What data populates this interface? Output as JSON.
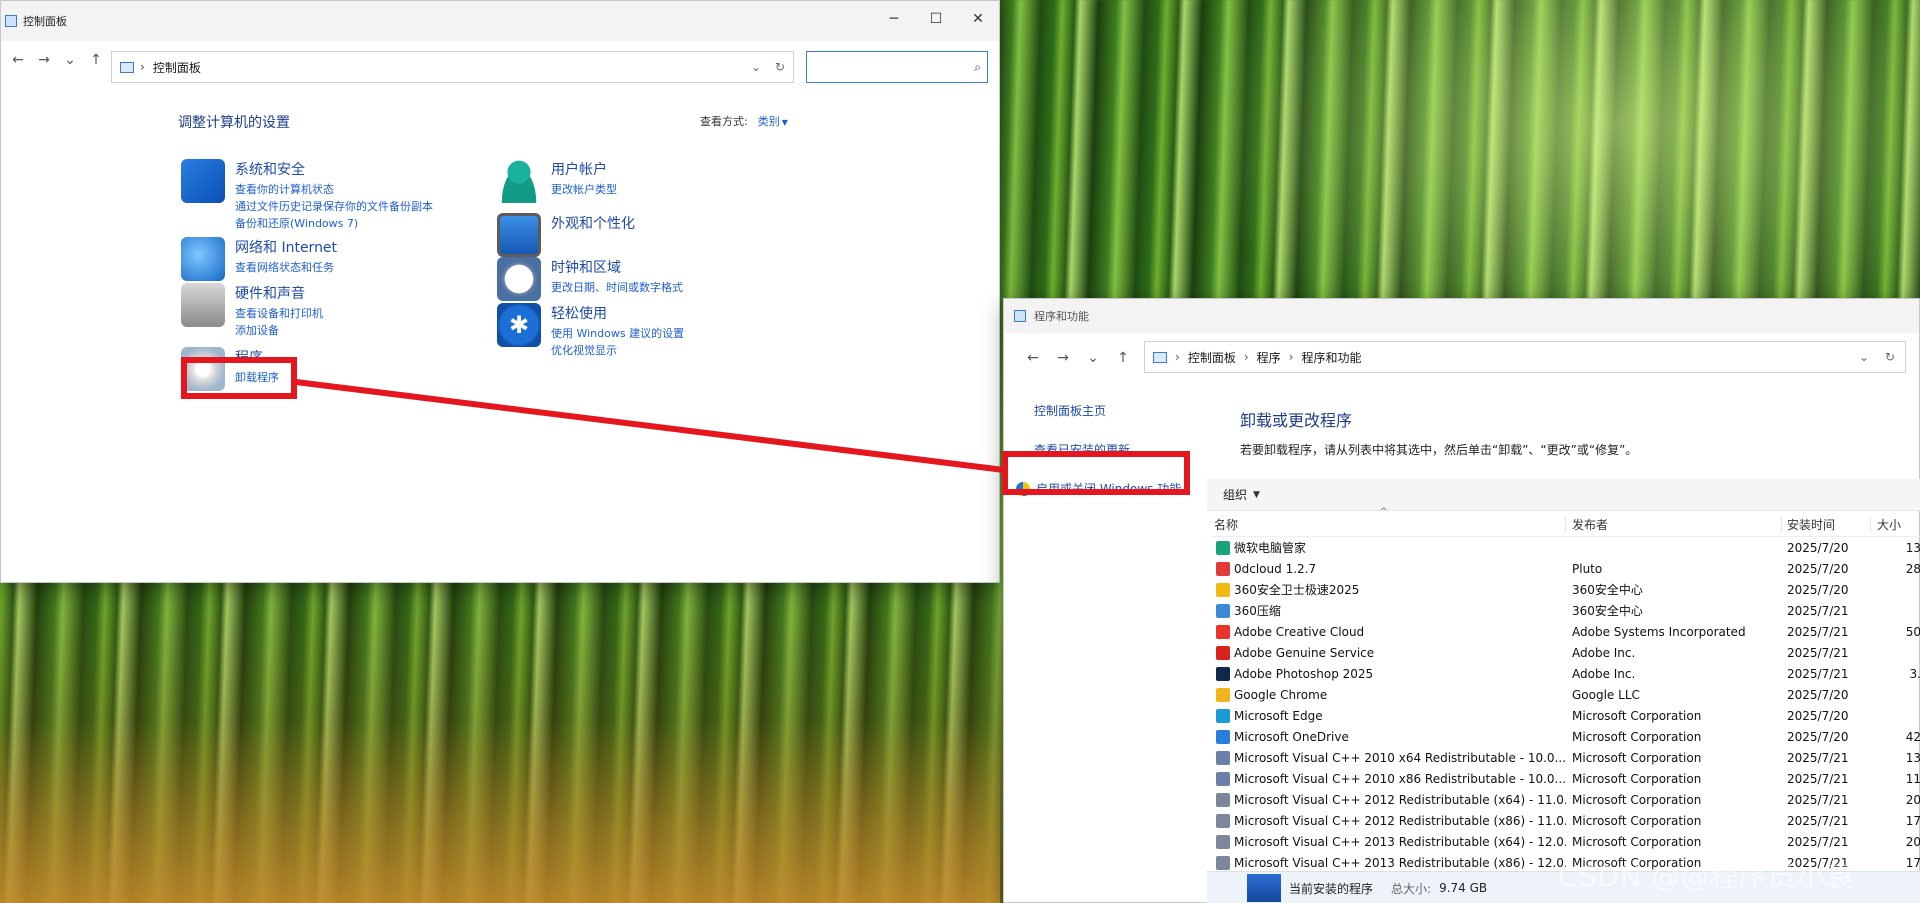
{
  "control_panel": {
    "title": "控制面板",
    "address": "控制面板",
    "heading": "调整计算机的设置",
    "view_label": "查看方式:",
    "view_value": "类别",
    "categories": [
      {
        "head": "系统和安全",
        "subs": [
          "查看你的计算机状态",
          "通过文件历史记录保存你的文件备份副本",
          "备份和还原(Windows 7)"
        ],
        "icon": "shield-icon"
      },
      {
        "head": "网络和 Internet",
        "subs": [
          "查看网络状态和任务"
        ],
        "icon": "globe-icon"
      },
      {
        "head": "硬件和声音",
        "subs": [
          "查看设备和打印机",
          "添加设备"
        ],
        "icon": "printer-icon"
      },
      {
        "head": "程序",
        "subs": [
          "卸载程序"
        ],
        "icon": "disc-icon"
      },
      {
        "head": "用户帐户",
        "subs": [
          "更改帐户类型"
        ],
        "icon": "user-icon"
      },
      {
        "head": "外观和个性化",
        "subs": [],
        "icon": "monitor-icon"
      },
      {
        "head": "时钟和区域",
        "subs": [
          "更改日期、时间或数字格式"
        ],
        "icon": "clock-icon"
      },
      {
        "head": "轻松使用",
        "subs": [
          "使用 Windows 建议的设置",
          "优化视觉显示"
        ],
        "icon": "accessibility-icon"
      }
    ]
  },
  "programs": {
    "title": "程序和功能",
    "breadcrumb": [
      "控制面板",
      "程序",
      "程序和功能"
    ],
    "sidebar": [
      "控制面板主页",
      "查看已安装的更新",
      "启用或关闭 Windows 功能"
    ],
    "heading": "卸载或更改程序",
    "description": "若要卸载程序，请从列表中将其选中，然后单击“卸载”、“更改”或“修复”。",
    "organize": "组织",
    "columns": [
      "名称",
      "发布者",
      "安装时间",
      "大小"
    ],
    "rows": [
      {
        "name": "微软电脑管家",
        "publisher": "",
        "date": "2025/7/20",
        "size": "13",
        "color": "#1aa37a"
      },
      {
        "name": "0dcloud 1.2.7",
        "publisher": "Pluto",
        "date": "2025/7/20",
        "size": "28",
        "color": "#e23b3b"
      },
      {
        "name": "360安全卫士极速2025",
        "publisher": "360安全中心",
        "date": "2025/7/20",
        "size": "",
        "color": "#f2b90f"
      },
      {
        "name": "360压缩",
        "publisher": "360安全中心",
        "date": "2025/7/21",
        "size": "",
        "color": "#3c8bd8"
      },
      {
        "name": "Adobe Creative Cloud",
        "publisher": "Adobe Systems Incorporated",
        "date": "2025/7/21",
        "size": "50",
        "color": "#e8342b"
      },
      {
        "name": "Adobe Genuine Service",
        "publisher": "Adobe Inc.",
        "date": "2025/7/21",
        "size": "",
        "color": "#d6231c"
      },
      {
        "name": "Adobe Photoshop 2025",
        "publisher": "Adobe Inc.",
        "date": "2025/7/21",
        "size": "3.",
        "color": "#0d2a4d"
      },
      {
        "name": "Google Chrome",
        "publisher": "Google LLC",
        "date": "2025/7/20",
        "size": "",
        "color": "#f1b51c"
      },
      {
        "name": "Microsoft Edge",
        "publisher": "Microsoft Corporation",
        "date": "2025/7/20",
        "size": "",
        "color": "#1b9bd7"
      },
      {
        "name": "Microsoft OneDrive",
        "publisher": "Microsoft Corporation",
        "date": "2025/7/20",
        "size": "42",
        "color": "#2a7fd9"
      },
      {
        "name": "Microsoft Visual C++ 2010  x64 Redistributable - 10.0....",
        "publisher": "Microsoft Corporation",
        "date": "2025/7/21",
        "size": "13",
        "color": "#6b7fa8"
      },
      {
        "name": "Microsoft Visual C++ 2010  x86 Redistributable - 10.0....",
        "publisher": "Microsoft Corporation",
        "date": "2025/7/21",
        "size": "11",
        "color": "#6b7fa8"
      },
      {
        "name": "Microsoft Visual C++ 2012 Redistributable (x64) - 11.0....",
        "publisher": "Microsoft Corporation",
        "date": "2025/7/21",
        "size": "20",
        "color": "#7d8799"
      },
      {
        "name": "Microsoft Visual C++ 2012 Redistributable (x86) - 11.0....",
        "publisher": "Microsoft Corporation",
        "date": "2025/7/21",
        "size": "17",
        "color": "#7d8799"
      },
      {
        "name": "Microsoft Visual C++ 2013 Redistributable (x64) - 12.0....",
        "publisher": "Microsoft Corporation",
        "date": "2025/7/21",
        "size": "20",
        "color": "#7d8799"
      },
      {
        "name": "Microsoft Visual C++ 2013 Redistributable (x86) - 12.0....",
        "publisher": "Microsoft Corporation",
        "date": "2025/7/21",
        "size": "17",
        "color": "#7d8799"
      }
    ],
    "status_label": "当前安装的程序",
    "total_label": "总大小:",
    "total_value": "9.74 GB"
  },
  "watermark": "CSDN @@程序员小袁",
  "accent_color": "#e4171e"
}
